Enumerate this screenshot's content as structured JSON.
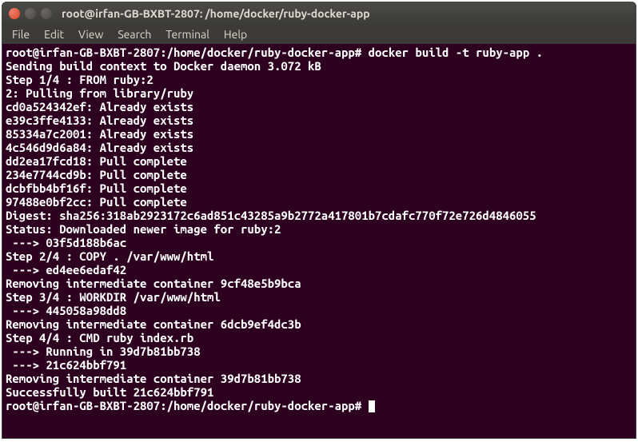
{
  "window": {
    "title": "root@irfan-GB-BXBT-2807: /home/docker/ruby-docker-app"
  },
  "menubar": {
    "items": [
      "File",
      "Edit",
      "View",
      "Search",
      "Terminal",
      "Help"
    ]
  },
  "terminal": {
    "prompt1_user": "root@irfan-GB-BXBT-2807",
    "prompt1_path": "/home/docker/ruby-docker-app",
    "prompt1_cmd": "docker build -t ruby-app .",
    "lines": [
      "Sending build context to Docker daemon 3.072 kB",
      "Step 1/4 : FROM ruby:2",
      "2: Pulling from library/ruby",
      "cd0a524342ef: Already exists",
      "e39c3ffe4133: Already exists",
      "85334a7c2001: Already exists",
      "4c546d9d6a84: Already exists",
      "dd2ea17fcd18: Pull complete",
      "234e7744cd9b: Pull complete",
      "dcbfbb4bf16f: Pull complete",
      "97488e0bf2cc: Pull complete",
      "Digest: sha256:318ab2923172c6ad851c43285a9b2772a417801b7cdafc770f72e726d4846055",
      "Status: Downloaded newer image for ruby:2",
      " ---> 03f5d188b6ac",
      "Step 2/4 : COPY . /var/www/html",
      " ---> ed4ee6edaf42",
      "Removing intermediate container 9cf48e5b9bca",
      "Step 3/4 : WORKDIR /var/www/html",
      " ---> 445058a98dd8",
      "Removing intermediate container 6dcb9ef4dc3b",
      "Step 4/4 : CMD ruby index.rb",
      " ---> Running in 39d7b81bb738",
      " ---> 21c624bbf791",
      "Removing intermediate container 39d7b81bb738",
      "Successfully built 21c624bbf791"
    ],
    "prompt2_user": "root@irfan-GB-BXBT-2807",
    "prompt2_path": "/home/docker/ruby-docker-app"
  }
}
